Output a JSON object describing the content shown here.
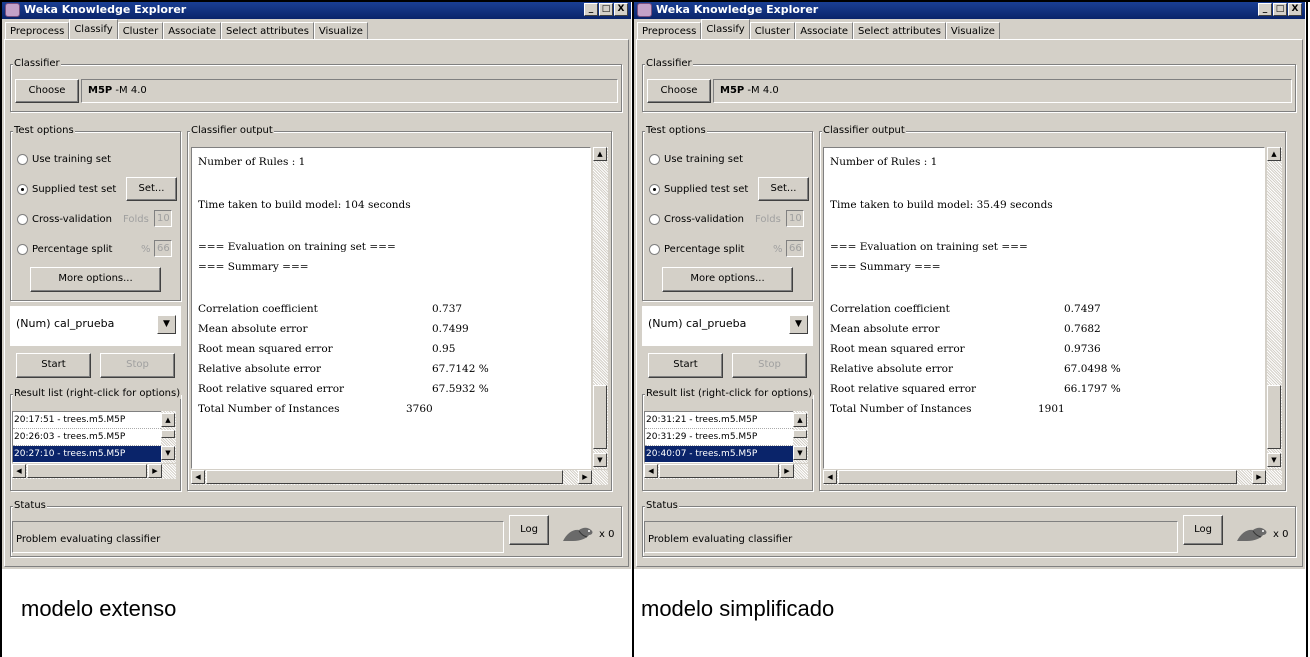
{
  "window": {
    "title": "Weka Knowledge Explorer",
    "controls": [
      "_",
      "□",
      "X"
    ]
  },
  "tabs": [
    "Preprocess",
    "Classify",
    "Cluster",
    "Associate",
    "Select attributes",
    "Visualize"
  ],
  "active_tab": "Classify",
  "classifier": {
    "legend": "Classifier",
    "choose_label": "Choose",
    "name": "M5P",
    "options": " -M 4.0"
  },
  "test_options": {
    "legend": "Test options",
    "use_training_set": "Use training set",
    "supplied_test_set": "Supplied test set",
    "set_button": "Set...",
    "cross_validation": "Cross-validation",
    "folds_label": "Folds",
    "folds_value": "10",
    "percentage_split": "Percentage split",
    "percent_label": "%",
    "percent_value": "66",
    "more_options": "More options..."
  },
  "target": "(Num) cal_prueba",
  "start_label": "Start",
  "stop_label": "Stop",
  "result_list_legend": "Result list (right-click for options)",
  "output_legend": "Classifier output",
  "status": {
    "legend": "Status",
    "text": "Problem evaluating classifier",
    "log_label": "Log",
    "count": "x 0"
  },
  "output_common": {
    "rules": "Number of Rules : 1",
    "eval_header": "=== Evaluation on training set ===",
    "summary_header": "=== Summary ===",
    "metric_labels": {
      "corr": "Correlation coefficient",
      "mae": "Mean absolute error",
      "rmse": "Root mean squared error",
      "rae": "Relative absolute error",
      "rrse": "Root relative squared error",
      "total": "Total Number of Instances"
    }
  },
  "panels": [
    {
      "caption": "modelo extenso",
      "time": "Time taken to build model: 104 seconds",
      "results": [
        "20:17:51 - trees.m5.M5P",
        "20:26:03 - trees.m5.M5P",
        "20:27:10 - trees.m5.M5P"
      ],
      "metrics": {
        "corr": "0.737",
        "mae": "0.7499",
        "rmse": "0.95",
        "rae": "67.7142 %",
        "rrse": "67.5932 %",
        "total": "3760"
      }
    },
    {
      "caption": "modelo simplificado",
      "time": "Time taken to build model: 35.49 seconds",
      "results": [
        "20:31:21 - trees.m5.M5P",
        "20:31:29 - trees.m5.M5P",
        "20:40:07 - trees.m5.M5P"
      ],
      "metrics": {
        "corr": "0.7497",
        "mae": "0.7682",
        "rmse": "0.9736",
        "rae": "67.0498 %",
        "rrse": "66.1797 %",
        "total": "1901"
      }
    }
  ]
}
